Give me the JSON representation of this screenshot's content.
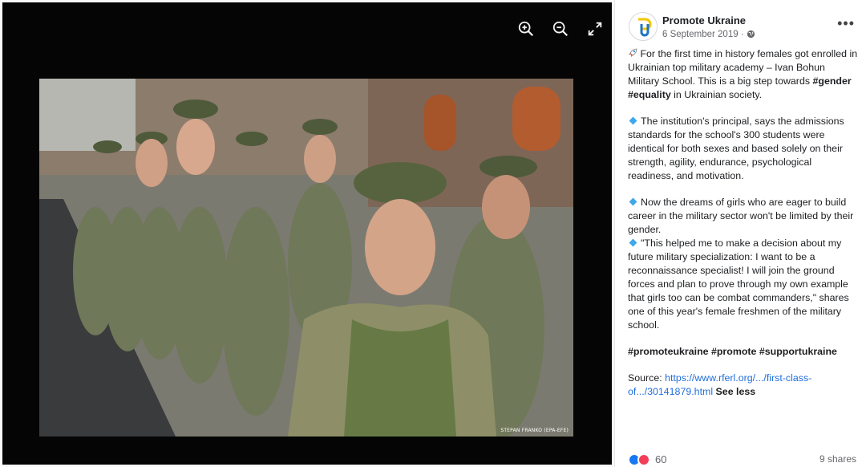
{
  "viewer": {
    "tools": [
      "zoom-in-icon",
      "zoom-out-icon",
      "fullscreen-icon"
    ],
    "photo_credit": "STEPAN FRANKO (EPA-EFE)"
  },
  "post": {
    "page_name": "Promote Ukraine",
    "date": "6 September 2019 ·",
    "p1_text": "For the first time in history females got enrolled in Ukrainian top military academy – Ivan Bohun Military School. This is a big step towards",
    "p1_tag1": "#gender",
    "p1_tag2": "#equality",
    "p1_tail": "in Ukrainian society.",
    "p2": "The institution's principal, says the admissions standards for the school's 300 students were identical for both sexes and based solely on their strength, agility, endurance, psychological readiness, and motivation.",
    "p3": "Now the dreams of girls who are eager to build career in the military sector won't be limited by their gender.",
    "p4": "\"This helped me to make a decision about my future military specialization: I want to be a reconnaissance specialist! I will join the ground forces and plan to prove through my own example that girls too can be combat commanders,\" shares one of this year's female freshmen of the military school.",
    "hashtags": "#promoteukraine #promote #supportukraine",
    "source_label": "Source:",
    "source_link": "https://www.rferl.org/.../first-class-of.../30141879.html",
    "see_less": "See less",
    "reaction_count": "60",
    "shares": "9 shares"
  },
  "colors": {
    "accent_link": "#216fdb",
    "bullet": "#3fa8ea",
    "viewer_bg": "#050505"
  }
}
